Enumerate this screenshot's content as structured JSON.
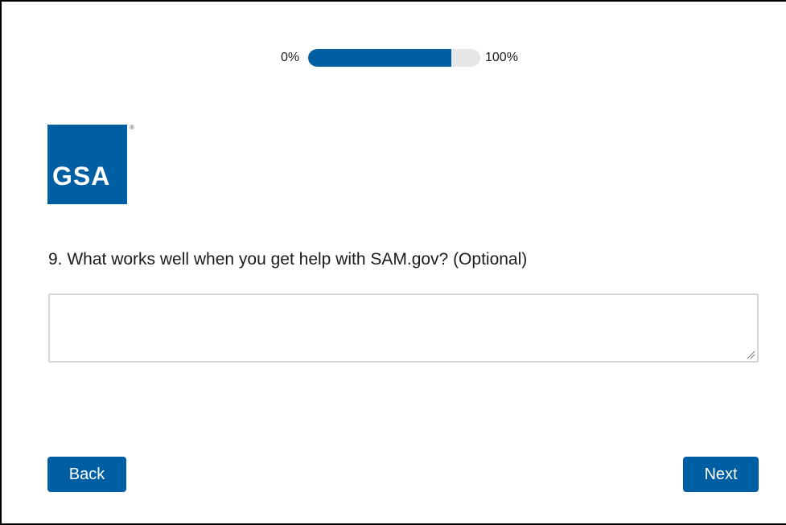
{
  "progress": {
    "min_label": "0%",
    "max_label": "100%",
    "value_percent": 83
  },
  "logo": {
    "text": "GSA",
    "registered": "®",
    "color": "#005ea2"
  },
  "question": {
    "text": "9. What works well when you get help with SAM.gov? (Optional)",
    "answer_value": ""
  },
  "buttons": {
    "back_label": "Back",
    "next_label": "Next",
    "color": "#005ea2"
  }
}
